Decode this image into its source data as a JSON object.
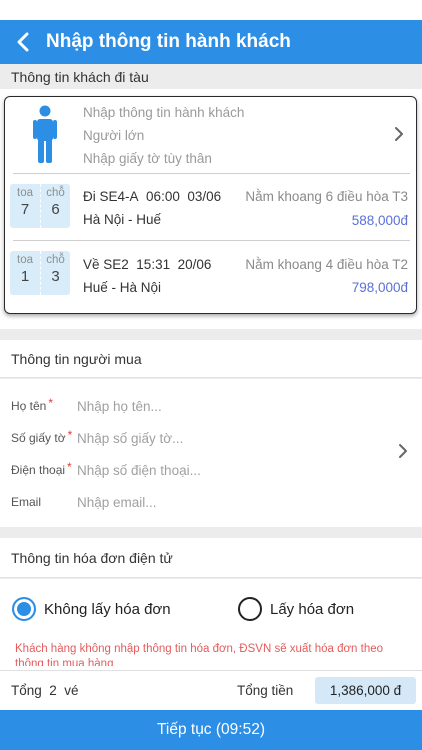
{
  "header": {
    "title": "Nhập thông tin hành khách"
  },
  "passenger_section": {
    "title": "Thông tin khách đi tàu",
    "passenger": {
      "name_placeholder": "Nhập thông tin hành khách",
      "type": "Người lớn",
      "id_placeholder": "Nhập giấy tờ tùy thân"
    },
    "trips": [
      {
        "car_label": "toa",
        "car": "7",
        "seat_label": "chỗ",
        "seat": "6",
        "train": "Đi SE4-A",
        "time": "06:00",
        "date": "03/06",
        "route": "Hà Nội - Huế",
        "class": "Nằm khoang 6 điều hòa T3",
        "price": "588,000đ"
      },
      {
        "car_label": "toa",
        "car": "1",
        "seat_label": "chỗ",
        "seat": "3",
        "train": "Về SE2",
        "time": "15:31",
        "date": "20/06",
        "route": "Huế - Hà Nội",
        "class": "Nằm khoang 4 điều hòa T2",
        "price": "798,000đ"
      }
    ]
  },
  "buyer_section": {
    "title": "Thông tin người mua",
    "fields": {
      "name": {
        "label": "Họ tên",
        "placeholder": "Nhập họ tên..."
      },
      "id": {
        "label": "Số giấy tờ",
        "placeholder": "Nhập số giấy tờ..."
      },
      "phone": {
        "label": "Điện thoại",
        "placeholder": "Nhập số điện thoại..."
      },
      "email": {
        "label": "Email",
        "placeholder": "Nhập email..."
      }
    },
    "required_mark": "*"
  },
  "invoice_section": {
    "title": "Thông tin hóa đơn điện tử",
    "option_no": "Không lấy hóa đơn",
    "option_yes": "Lấy hóa đơn",
    "selected": "no",
    "note": "Khách hàng không nhập thông tin hóa đơn, ĐSVN sẽ xuất hóa đơn theo thông tin mua hàng"
  },
  "footer": {
    "count_text": "Tổng  2  vé",
    "total_label": "Tổng tiền",
    "total_value": "1,386,000 đ",
    "continue_label": "Tiếp tục (09:52)"
  },
  "colors": {
    "accent": "#2d8ee6",
    "price": "#5b70d6",
    "required": "#e53935",
    "note": "#e65b5b"
  }
}
